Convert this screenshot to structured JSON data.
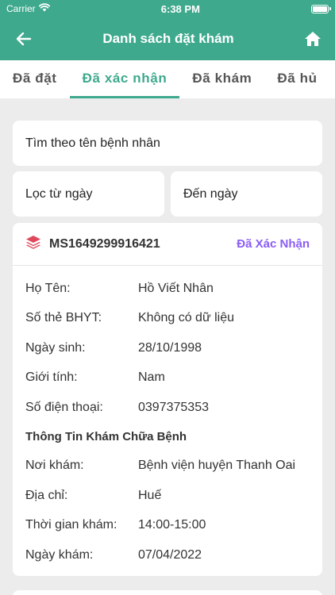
{
  "status_bar": {
    "carrier": "Carrier",
    "time": "6:38 PM"
  },
  "header": {
    "title": "Danh sách đặt khám",
    "back_icon": "back-arrow-icon",
    "home_icon": "home-icon"
  },
  "tabs": [
    {
      "label": "Đã đặt",
      "active": false
    },
    {
      "label": "Đã xác nhận",
      "active": true
    },
    {
      "label": "Đã khám",
      "active": false
    },
    {
      "label": "Đã hủ",
      "active": false
    }
  ],
  "filters": {
    "search_placeholder": "Tìm theo tên bệnh nhân",
    "from_date_placeholder": "Lọc từ ngày",
    "to_date_placeholder": "Đến ngày"
  },
  "booking": {
    "code": "MS1649299916421",
    "status": "Đã Xác Nhận",
    "status_color": "#8b5cf6",
    "icon_color": "#e0475b",
    "patient": [
      {
        "label": "Họ Tên:",
        "value": "Hồ Viết Nhân"
      },
      {
        "label": "Số thẻ BHYT:",
        "value": "Không có dữ liệu"
      },
      {
        "label": "Ngày sinh:",
        "value": "28/10/1998"
      },
      {
        "label": "Giới tính:",
        "value": "Nam"
      },
      {
        "label": "Số điện thoại:",
        "value": "0397375353"
      }
    ],
    "section_title": "Thông Tin Khám Chữa Bệnh",
    "exam": [
      {
        "label": "Nơi khám:",
        "value": "Bệnh viện huyện Thanh Oai"
      },
      {
        "label": "Địa chỉ:",
        "value": "Huế"
      },
      {
        "label": "Thời gian khám:",
        "value": "14:00-15:00"
      },
      {
        "label": "Ngày khám:",
        "value": "07/04/2022"
      }
    ]
  },
  "colors": {
    "primary": "#3fa98e",
    "background": "#ececec"
  }
}
